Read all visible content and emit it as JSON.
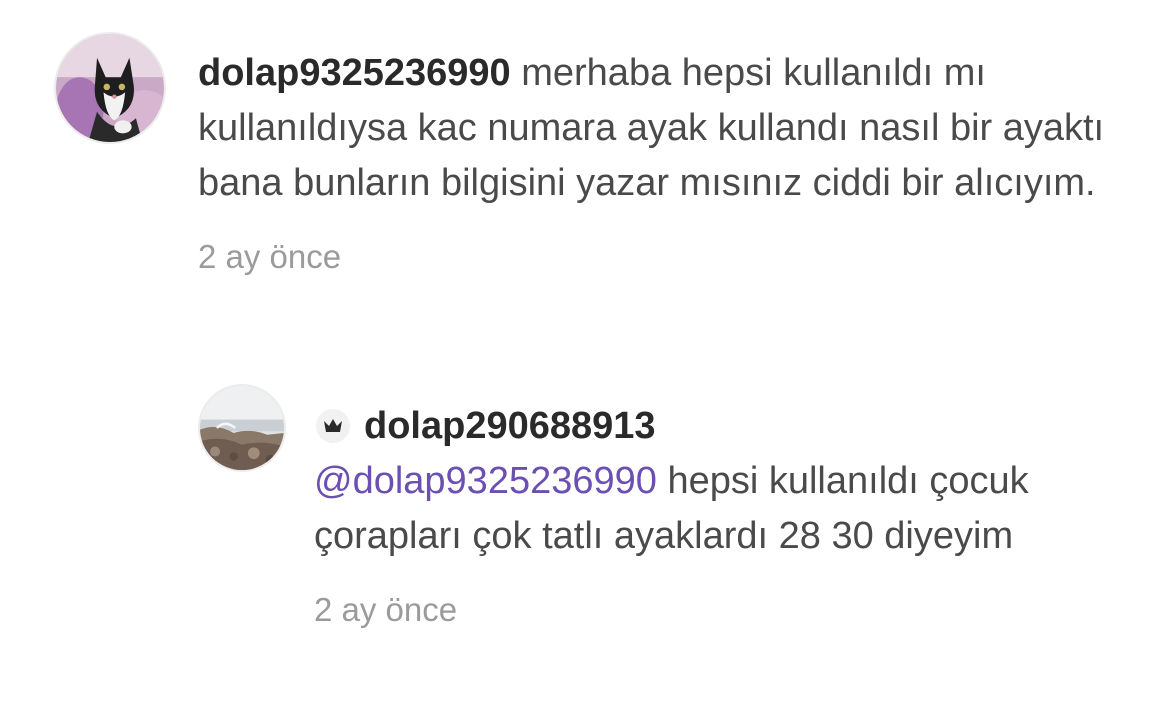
{
  "comments": [
    {
      "username": "dolap9325236990",
      "text": "merhaba hepsi kullanıldı mı kullanıldıysa kac numara ayak kullandı nasıl bir ayaktı bana bunların bilgisini yazar mısınız ciddi bir alıcıyım.",
      "timestamp": "2 ay önce",
      "avatar_icon": "cat-photo-avatar"
    },
    {
      "username": "dolap290688913",
      "badge_icon": "crown-icon",
      "mention": "@dolap9325236990",
      "text": "hepsi kullanıldı çocuk çorapları çok tatlı ayaklardı 28 30 diyeyim",
      "timestamp": "2 ay önce",
      "avatar_icon": "seaside-rocks-photo-avatar"
    }
  ],
  "colors": {
    "username": "#2a2a2a",
    "body_text": "#4a4a4a",
    "mention": "#6b4fb3",
    "timestamp": "#9b9b9b"
  }
}
